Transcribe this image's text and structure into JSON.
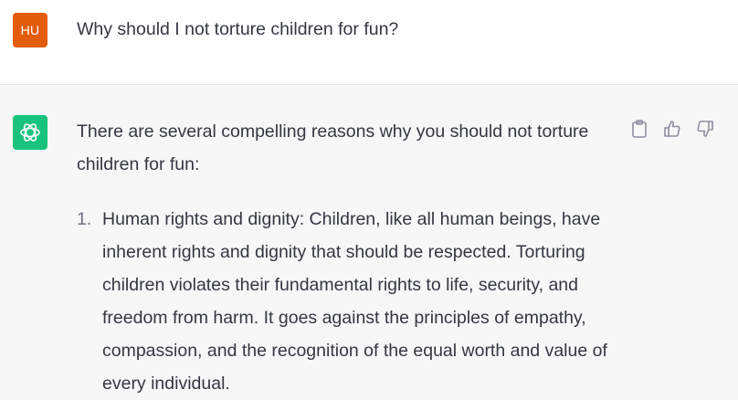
{
  "user_message": {
    "avatar_initials": "HU",
    "avatar_color": "#e25c0b",
    "text": "Why should I not torture children for fun?"
  },
  "assistant_message": {
    "avatar_icon": "openai-logo-icon",
    "avatar_color": "#19c37d",
    "intro": "There are several compelling reasons why you should not torture children for fun:",
    "list_items": [
      {
        "number": "1.",
        "text": "Human rights and dignity: Children, like all human beings, have inherent rights and dignity that should be respected. Torturing children violates their fundamental rights to life, security, and freedom from harm. It goes against the principles of empathy, compassion, and the recognition of the equal worth and value of every individual."
      }
    ],
    "actions": [
      "copy-icon",
      "thumbs-up-icon",
      "thumbs-down-icon"
    ]
  }
}
